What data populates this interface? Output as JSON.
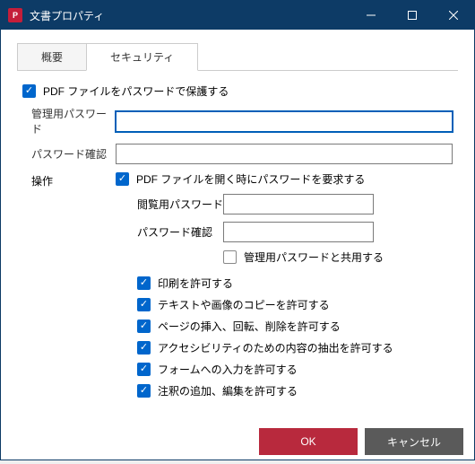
{
  "window": {
    "title": "文書プロパティ"
  },
  "tabs": {
    "summary": "概要",
    "security": "セキュリティ"
  },
  "security": {
    "protect_label": "PDF ファイルをパスワードで保護する",
    "admin_password_label": "管理用パスワード",
    "confirm_password_label": "パスワード確認",
    "operations_label": "操作",
    "require_open_password_label": "PDF ファイルを開く時にパスワードを要求する",
    "view_password_label": "閲覧用パスワード",
    "view_confirm_label": "パスワード確認",
    "share_admin_label": "管理用パスワードと共用する",
    "perm_print": "印刷を許可する",
    "perm_copy": "テキストや画像のコピーを許可する",
    "perm_page_ops": "ページの挿入、回転、削除を許可する",
    "perm_accessibility": "アクセシビリティのための内容の抽出を許可する",
    "perm_form": "フォームへの入力を許可する",
    "perm_annot": "注釈の追加、編集を許可する"
  },
  "buttons": {
    "ok": "OK",
    "cancel": "キャンセル"
  },
  "state": {
    "protect_checked": true,
    "require_open_checked": true,
    "share_admin_checked": false,
    "perm_print_checked": true,
    "perm_copy_checked": true,
    "perm_page_ops_checked": true,
    "perm_accessibility_checked": true,
    "perm_form_checked": true,
    "perm_annot_checked": true
  }
}
